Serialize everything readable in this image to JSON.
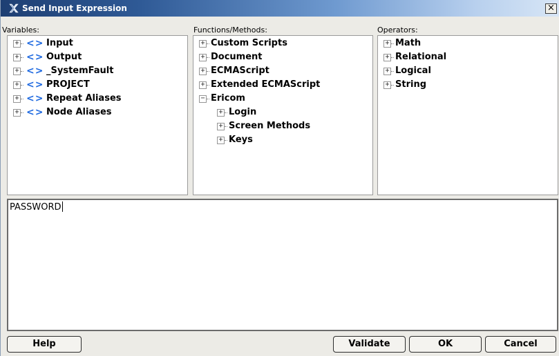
{
  "window": {
    "title": "Send Input Expression",
    "close_label": "×"
  },
  "panes": {
    "variables": {
      "header": "Variables:",
      "items": [
        {
          "label": "Input",
          "expander": "+",
          "icon": "variable-brackets-icon"
        },
        {
          "label": "Output",
          "expander": "+",
          "icon": "variable-brackets-icon"
        },
        {
          "label": "_SystemFault",
          "expander": "+",
          "icon": "variable-brackets-icon"
        },
        {
          "label": "PROJECT",
          "expander": "+",
          "icon": "variable-brackets-icon"
        },
        {
          "label": "Repeat Aliases",
          "expander": "+",
          "icon": "variable-brackets-icon"
        },
        {
          "label": "Node Aliases",
          "expander": "+",
          "icon": "variable-brackets-icon"
        }
      ],
      "icon_glyph": "<>"
    },
    "functions": {
      "header": "Functions/Methods:",
      "items": [
        {
          "label": "Custom Scripts",
          "expander": "+"
        },
        {
          "label": "Document",
          "expander": "+"
        },
        {
          "label": "ECMAScript",
          "expander": "+"
        },
        {
          "label": "Extended ECMAScript",
          "expander": "+"
        },
        {
          "label": "Ericom",
          "expander": "−"
        },
        {
          "label": "Login",
          "expander": "+"
        },
        {
          "label": "Screen Methods",
          "expander": "+"
        },
        {
          "label": "Keys",
          "expander": "+"
        }
      ]
    },
    "operators": {
      "header": "Operators:",
      "items": [
        {
          "label": "Math",
          "expander": "+"
        },
        {
          "label": "Relational",
          "expander": "+"
        },
        {
          "label": "Logical",
          "expander": "+"
        },
        {
          "label": "String",
          "expander": "+"
        }
      ]
    }
  },
  "expression": {
    "value": "PASSWORD"
  },
  "buttons": {
    "help": "Help",
    "validate": "Validate",
    "ok": "OK",
    "cancel": "Cancel"
  },
  "colors": {
    "titlebar_start": "#1e3f73",
    "titlebar_end": "#d8e6f6",
    "variable_icon": "#1e69e0",
    "dialog_bg": "#ecebe6"
  }
}
